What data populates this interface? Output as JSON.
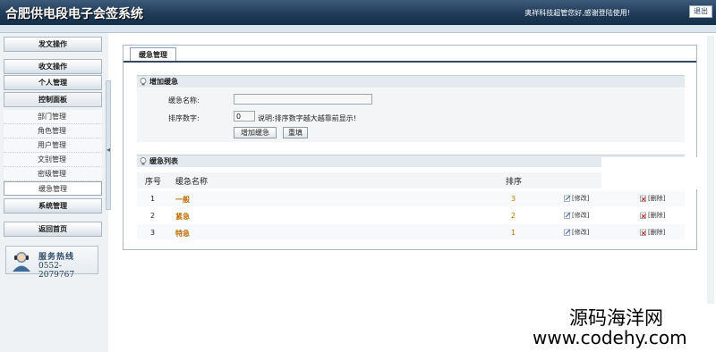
{
  "header": {
    "title": "合肥供电段电子会签系统",
    "welcome": "奥祥科技超管您好,感谢登陆使用!",
    "logout_label": "退出"
  },
  "sidebar": {
    "menu": {
      "send": "发文操作",
      "receive": "收文操作",
      "personal": "个人管理",
      "control": "控制面板",
      "system": "系统管理",
      "home": "返回首页"
    },
    "submenu": [
      "部门管理",
      "角色管理",
      "用户管理",
      "文别管理",
      "密级管理",
      "缓急管理"
    ],
    "hotline": {
      "title": "服务热线",
      "phone": "0552-2079767"
    }
  },
  "main": {
    "tab_label": "缓急管理",
    "add_section": {
      "title": "增加缓急",
      "name_label": "缓急名称:",
      "name_value": "",
      "order_label": "排序数字:",
      "order_value": "0",
      "hint": "说明:排序数字越大越靠前显示!",
      "add_button": "增加缓急",
      "reset_button": "重填"
    },
    "list_section": {
      "title": "缓急列表",
      "columns": {
        "index": "序号",
        "name": "缓急名称",
        "order": "排序"
      },
      "rows": [
        {
          "index": "1",
          "name": "一般",
          "order": "3",
          "edit": "[修改]",
          "delete": "[删除]"
        },
        {
          "index": "2",
          "name": "紧急",
          "order": "2",
          "edit": "[修改]",
          "delete": "[删除]"
        },
        {
          "index": "3",
          "name": "特急",
          "order": "1",
          "edit": "[修改]",
          "delete": "[删除]"
        }
      ]
    }
  },
  "watermark": {
    "line1": "源码海洋网",
    "line2": "www.codehy.com"
  },
  "colors": {
    "header": "#1f3b58",
    "accent": "#c06a00",
    "tab_line": "#32495f"
  }
}
